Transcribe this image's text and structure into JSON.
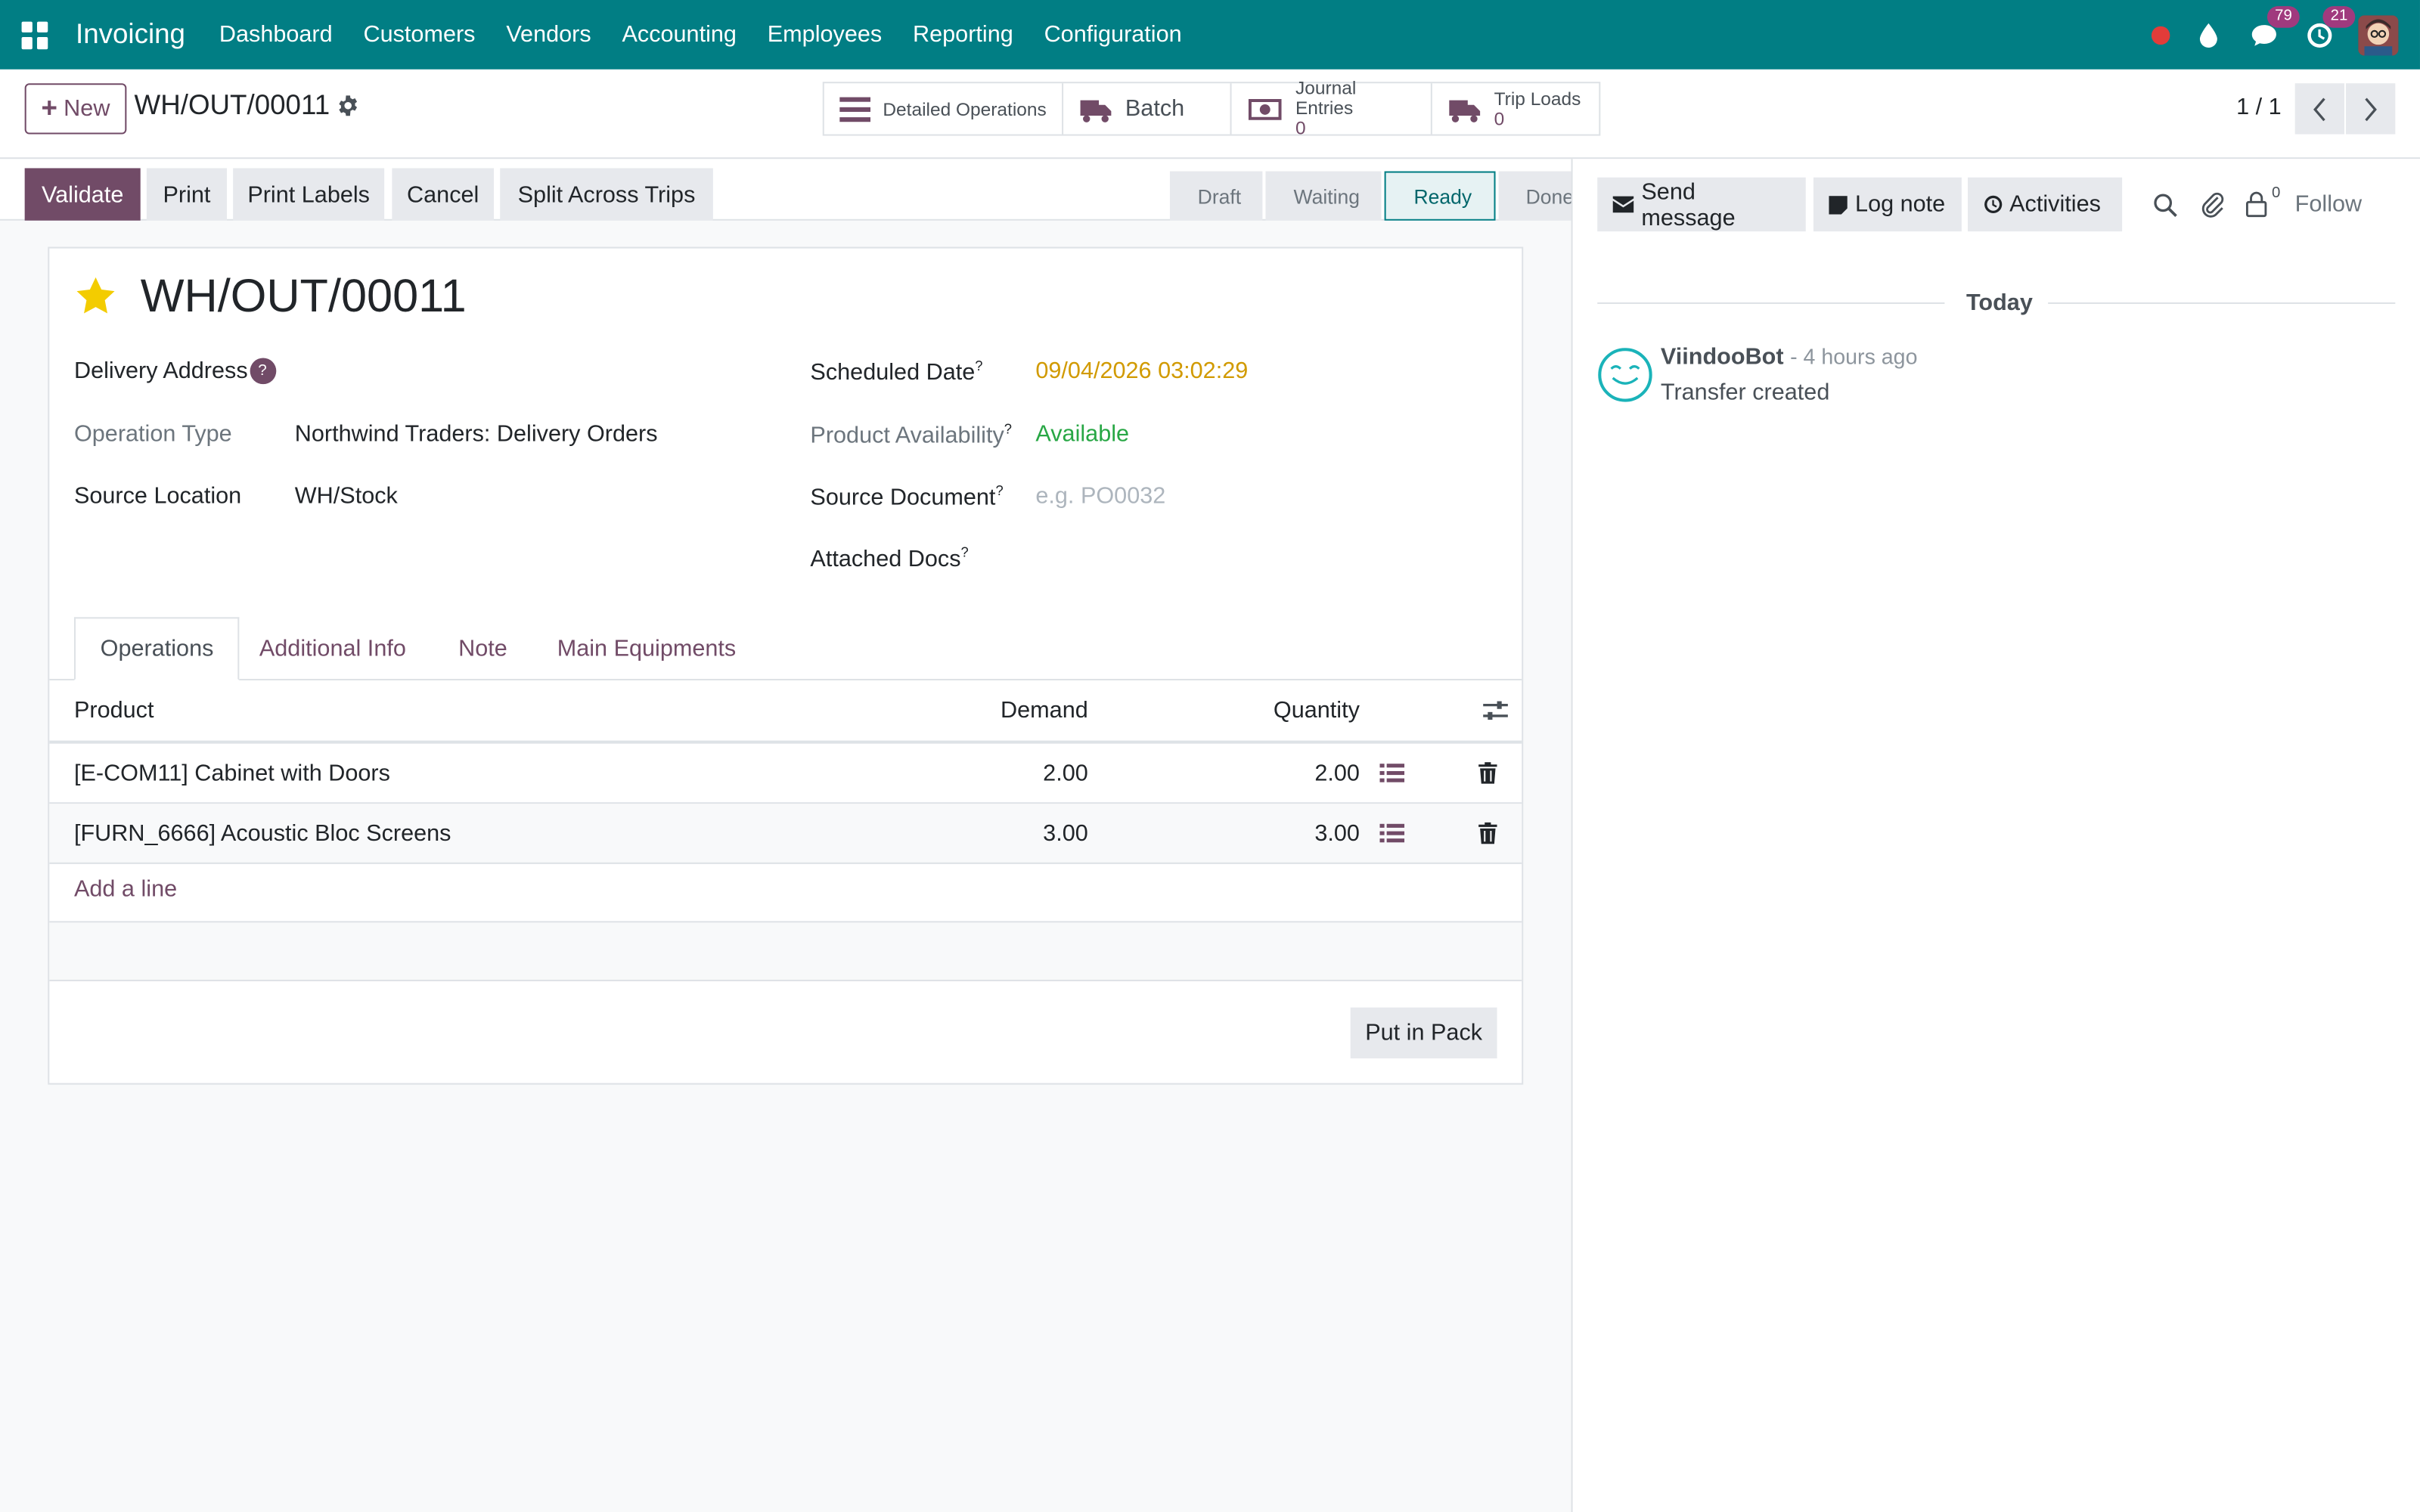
{
  "navbar": {
    "app_name": "Invoicing",
    "menus": [
      "Dashboard",
      "Customers",
      "Vendors",
      "Accounting",
      "Employees",
      "Reporting",
      "Configuration"
    ],
    "messages_count": "79",
    "activities_count": "21"
  },
  "control_panel": {
    "new_label": "New",
    "breadcrumb": "WH/OUT/00011",
    "smart_buttons": {
      "detailed_operations": "Detailed Operations",
      "batch": "Batch",
      "journal_entries_label": "Journal Entries",
      "journal_entries_value": "0",
      "trip_loads_label": "Trip Loads",
      "trip_loads_value": "0"
    },
    "pager": "1 / 1"
  },
  "statusbar": {
    "buttons": {
      "validate": "Validate",
      "print": "Print",
      "print_labels": "Print Labels",
      "cancel": "Cancel",
      "split": "Split Across Trips"
    },
    "stages": [
      "Draft",
      "Waiting",
      "Ready",
      "Done"
    ],
    "active_stage": "Ready"
  },
  "form": {
    "title": "WH/OUT/00011",
    "delivery_address_label": "Delivery Address",
    "help_mark": "?",
    "operation_type_label": "Operation Type",
    "operation_type_value": "Northwind Traders: Delivery Orders",
    "source_location_label": "Source Location",
    "source_location_value": "WH/Stock",
    "scheduled_date_label": "Scheduled Date",
    "scheduled_date_value": "09/04/2026 03:02:29",
    "product_availability_label": "Product Availability",
    "product_availability_value": "Available",
    "source_document_label": "Source Document",
    "source_document_placeholder": "e.g. PO0032",
    "attached_docs_label": "Attached Docs",
    "sup_mark": "?"
  },
  "tabs": [
    "Operations",
    "Additional Info",
    "Note",
    "Main Equipments"
  ],
  "table": {
    "headers": {
      "product": "Product",
      "demand": "Demand",
      "quantity": "Quantity"
    },
    "rows": [
      {
        "product": "[E-COM11] Cabinet with Doors",
        "demand": "2.00",
        "quantity": "2.00"
      },
      {
        "product": "[FURN_6666] Acoustic Bloc Screens",
        "demand": "3.00",
        "quantity": "3.00"
      }
    ],
    "add_line": "Add a line",
    "put_in_pack": "Put in Pack"
  },
  "chatter": {
    "send_message": "Send message",
    "log_note": "Log note",
    "activities": "Activities",
    "followers_count": "0",
    "follow": "Follow",
    "date_separator": "Today",
    "message": {
      "author": "ViindooBot",
      "time": "- 4 hours ago",
      "body": "Transfer created"
    }
  },
  "colors": {
    "navbar": "#017e84",
    "primary": "#714b67",
    "warning_date": "#d19a00",
    "available": "#28a745"
  }
}
